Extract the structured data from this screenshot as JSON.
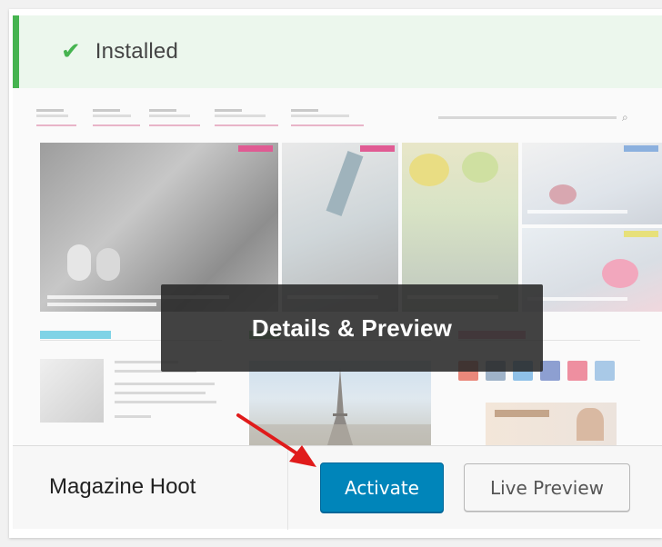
{
  "notice": {
    "icon": "checkmark-icon",
    "text": "Installed",
    "color": "#46b450"
  },
  "screenshot": {
    "overlay_label": "Details & Preview"
  },
  "theme": {
    "name": "Magazine Hoot"
  },
  "actions": {
    "activate_label": "Activate",
    "live_preview_label": "Live Preview"
  },
  "colors": {
    "primary": "#0085ba",
    "annotation_arrow": "#e01b1b"
  }
}
